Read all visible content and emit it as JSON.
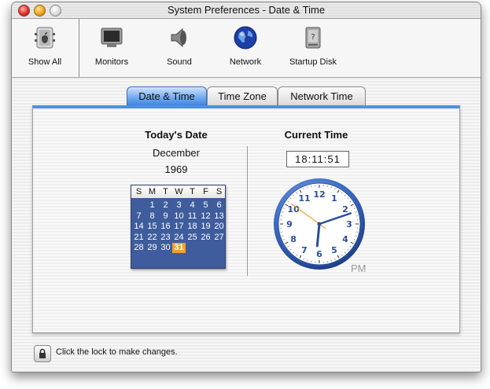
{
  "window": {
    "title": "System Preferences - Date & Time"
  },
  "toolbar": {
    "items": [
      {
        "label": "Show All",
        "icon": "apple-switch-icon"
      },
      {
        "label": "Monitors",
        "icon": "monitor-icon"
      },
      {
        "label": "Sound",
        "icon": "speaker-icon"
      },
      {
        "label": "Network",
        "icon": "globe-icon"
      },
      {
        "label": "Startup Disk",
        "icon": "hard-disk-icon"
      }
    ]
  },
  "tabs": [
    {
      "label": "Date & Time",
      "active": true
    },
    {
      "label": "Time Zone",
      "active": false
    },
    {
      "label": "Network Time",
      "active": false
    }
  ],
  "date": {
    "heading": "Today's Date",
    "month": "December",
    "year": "1969",
    "weekdays": [
      "S",
      "M",
      "T",
      "W",
      "T",
      "F",
      "S"
    ],
    "weeks": [
      [
        "",
        "1",
        "2",
        "3",
        "4",
        "5",
        "6"
      ],
      [
        "7",
        "8",
        "9",
        "10",
        "11",
        "12",
        "13"
      ],
      [
        "14",
        "15",
        "16",
        "17",
        "18",
        "19",
        "20"
      ],
      [
        "21",
        "22",
        "23",
        "24",
        "25",
        "26",
        "27"
      ],
      [
        "28",
        "29",
        "30",
        "31",
        "",
        "",
        ""
      ]
    ],
    "selected_day": "31"
  },
  "time": {
    "heading": "Current Time",
    "hours": "18",
    "minutes": "11",
    "seconds": "51",
    "separator": ":",
    "period": "PM",
    "dial_numbers": [
      "12",
      "1",
      "2",
      "3",
      "4",
      "5",
      "6",
      "7",
      "8",
      "9",
      "10",
      "11"
    ]
  },
  "colors": {
    "accent_blue": "#4f8fe0",
    "calendar_bg": "#3f5d9c",
    "selected_day": "#f2a02a",
    "second_hand": "#f2a02a"
  },
  "lock": {
    "text": "Click the lock to make changes."
  }
}
